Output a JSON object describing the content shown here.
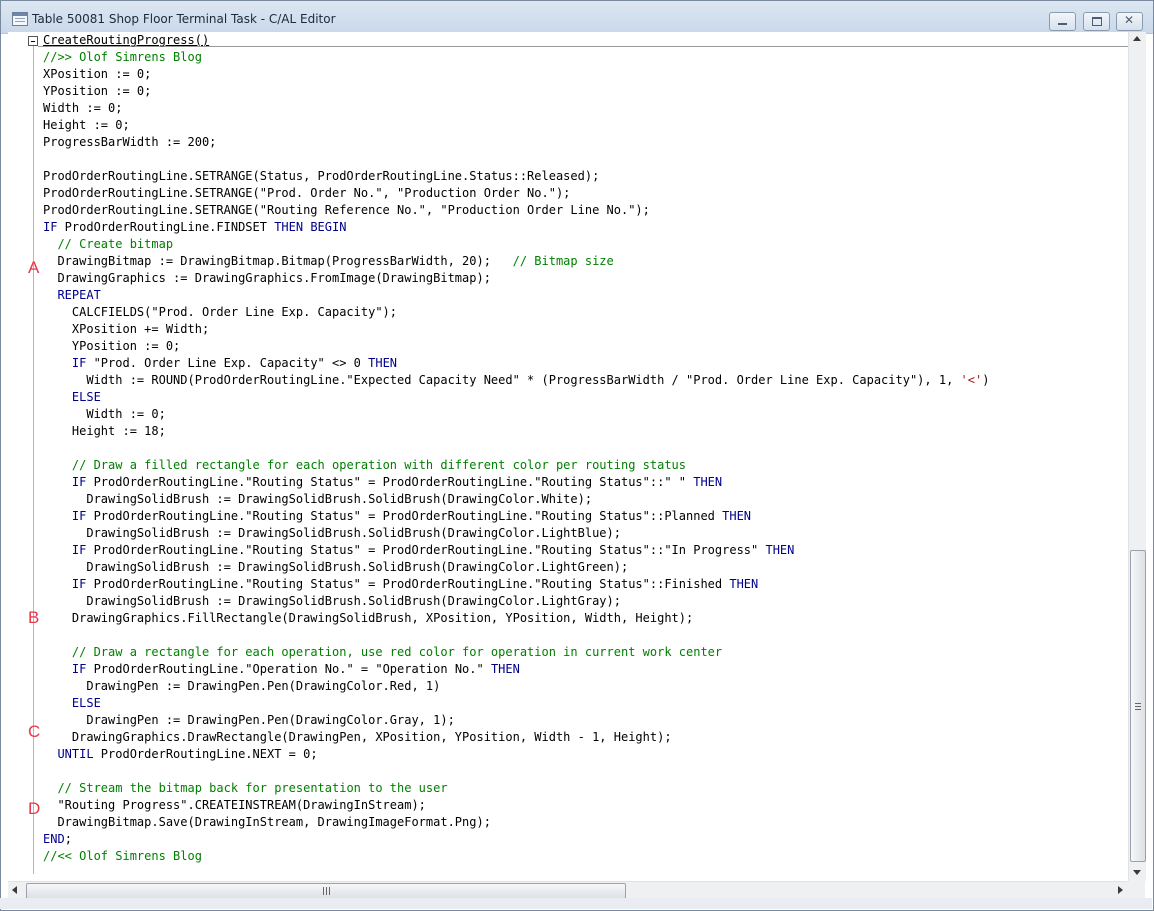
{
  "window": {
    "title": "Table 50081 Shop Floor Terminal Task - C/AL Editor"
  },
  "markers": [
    "A",
    "B",
    "C",
    "D"
  ],
  "code_lines": [
    [
      {
        "t": "CreateRoutingProgress()",
        "c": "proc"
      }
    ],
    [
      {
        "t": "//>> Olof Simrens Blog",
        "c": "cm"
      }
    ],
    [
      {
        "t": "XPosition := 0;"
      }
    ],
    [
      {
        "t": "YPosition := 0;"
      }
    ],
    [
      {
        "t": "Width := 0;"
      }
    ],
    [
      {
        "t": "Height := 0;"
      }
    ],
    [
      {
        "t": "ProgressBarWidth := 200;"
      }
    ],
    [
      {
        "t": ""
      }
    ],
    [
      {
        "t": "ProdOrderRoutingLine.SETRANGE(Status, ProdOrderRoutingLine.Status::Released);"
      }
    ],
    [
      {
        "t": "ProdOrderRoutingLine.SETRANGE(\"Prod. Order No.\", \"Production Order No.\");"
      }
    ],
    [
      {
        "t": "ProdOrderRoutingLine.SETRANGE(\"Routing Reference No.\", \"Production Order Line No.\");"
      }
    ],
    [
      {
        "t": "IF",
        "c": "kw"
      },
      {
        "t": " ProdOrderRoutingLine.FINDSET "
      },
      {
        "t": "THEN BEGIN",
        "c": "kw"
      }
    ],
    [
      {
        "t": "  "
      },
      {
        "t": "// Create bitmap",
        "c": "cm"
      }
    ],
    [
      {
        "t": "  DrawingBitmap := DrawingBitmap.Bitmap(ProgressBarWidth, 20);   "
      },
      {
        "t": "// Bitmap size",
        "c": "cm"
      }
    ],
    [
      {
        "t": "  DrawingGraphics := DrawingGraphics.FromImage(DrawingBitmap);"
      }
    ],
    [
      {
        "t": "  "
      },
      {
        "t": "REPEAT",
        "c": "kw"
      }
    ],
    [
      {
        "t": "    CALCFIELDS(\"Prod. Order Line Exp. Capacity\");"
      }
    ],
    [
      {
        "t": "    XPosition += Width;"
      }
    ],
    [
      {
        "t": "    YPosition := 0;"
      }
    ],
    [
      {
        "t": "    "
      },
      {
        "t": "IF",
        "c": "kw"
      },
      {
        "t": " \"Prod. Order Line Exp. Capacity\" <> 0 "
      },
      {
        "t": "THEN",
        "c": "kw"
      }
    ],
    [
      {
        "t": "      Width := ROUND(ProdOrderRoutingLine.\"Expected Capacity Need\" * (ProgressBarWidth / \"Prod. Order Line Exp. Capacity\"), 1, "
      },
      {
        "t": "'<'",
        "c": "str"
      },
      {
        "t": ")"
      }
    ],
    [
      {
        "t": "    "
      },
      {
        "t": "ELSE",
        "c": "kw"
      }
    ],
    [
      {
        "t": "      Width := 0;"
      }
    ],
    [
      {
        "t": "    Height := 18;"
      }
    ],
    [
      {
        "t": ""
      }
    ],
    [
      {
        "t": "    "
      },
      {
        "t": "// Draw a filled rectangle for each operation with different color per routing status",
        "c": "cm"
      }
    ],
    [
      {
        "t": "    "
      },
      {
        "t": "IF",
        "c": "kw"
      },
      {
        "t": " ProdOrderRoutingLine.\"Routing Status\" = ProdOrderRoutingLine.\"Routing Status\"::\" \" "
      },
      {
        "t": "THEN",
        "c": "kw"
      }
    ],
    [
      {
        "t": "      DrawingSolidBrush := DrawingSolidBrush.SolidBrush(DrawingColor.White);"
      }
    ],
    [
      {
        "t": "    "
      },
      {
        "t": "IF",
        "c": "kw"
      },
      {
        "t": " ProdOrderRoutingLine.\"Routing Status\" = ProdOrderRoutingLine.\"Routing Status\"::Planned "
      },
      {
        "t": "THEN",
        "c": "kw"
      }
    ],
    [
      {
        "t": "      DrawingSolidBrush := DrawingSolidBrush.SolidBrush(DrawingColor.LightBlue);"
      }
    ],
    [
      {
        "t": "    "
      },
      {
        "t": "IF",
        "c": "kw"
      },
      {
        "t": " ProdOrderRoutingLine.\"Routing Status\" = ProdOrderRoutingLine.\"Routing Status\"::\"In Progress\" "
      },
      {
        "t": "THEN",
        "c": "kw"
      }
    ],
    [
      {
        "t": "      DrawingSolidBrush := DrawingSolidBrush.SolidBrush(DrawingColor.LightGreen);"
      }
    ],
    [
      {
        "t": "    "
      },
      {
        "t": "IF",
        "c": "kw"
      },
      {
        "t": " ProdOrderRoutingLine.\"Routing Status\" = ProdOrderRoutingLine.\"Routing Status\"::Finished "
      },
      {
        "t": "THEN",
        "c": "kw"
      }
    ],
    [
      {
        "t": "      DrawingSolidBrush := DrawingSolidBrush.SolidBrush(DrawingColor.LightGray);"
      }
    ],
    [
      {
        "t": "    DrawingGraphics.FillRectangle(DrawingSolidBrush, XPosition, YPosition, Width, Height);"
      }
    ],
    [
      {
        "t": ""
      }
    ],
    [
      {
        "t": "    "
      },
      {
        "t": "// Draw a rectangle for each operation, use red color for operation in current work center",
        "c": "cm"
      }
    ],
    [
      {
        "t": "    "
      },
      {
        "t": "IF",
        "c": "kw"
      },
      {
        "t": " ProdOrderRoutingLine.\"Operation No.\" = \"Operation No.\" "
      },
      {
        "t": "THEN",
        "c": "kw"
      }
    ],
    [
      {
        "t": "      DrawingPen := DrawingPen.Pen(DrawingColor.Red, 1)"
      }
    ],
    [
      {
        "t": "    "
      },
      {
        "t": "ELSE",
        "c": "kw"
      }
    ],
    [
      {
        "t": "      DrawingPen := DrawingPen.Pen(DrawingColor.Gray, 1);"
      }
    ],
    [
      {
        "t": "    DrawingGraphics.DrawRectangle(DrawingPen, XPosition, YPosition, Width - 1, Height);"
      }
    ],
    [
      {
        "t": "  "
      },
      {
        "t": "UNTIL",
        "c": "kw"
      },
      {
        "t": " ProdOrderRoutingLine.NEXT = 0;"
      }
    ],
    [
      {
        "t": ""
      }
    ],
    [
      {
        "t": "  "
      },
      {
        "t": "// Stream the bitmap back for presentation to the user",
        "c": "cm"
      }
    ],
    [
      {
        "t": "  \"Routing Progress\".CREATEINSTREAM(DrawingInStream);"
      }
    ],
    [
      {
        "t": "  DrawingBitmap.Save(DrawingInStream, DrawingImageFormat.Png);"
      }
    ],
    [
      {
        "t": "END",
        "c": "kw"
      },
      {
        "t": ";"
      }
    ],
    [
      {
        "t": "//<< Olof Simrens Blog",
        "c": "cm"
      }
    ]
  ],
  "icons": {
    "app": "table-icon",
    "minimize": "minimize-icon",
    "maximize": "maximize-icon",
    "close": "close-icon",
    "fold": "collapse-icon"
  }
}
